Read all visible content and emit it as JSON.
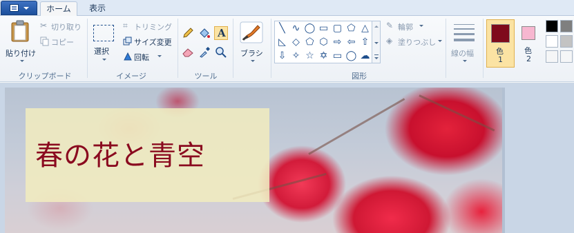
{
  "tabs": {
    "home": "ホーム",
    "view": "表示"
  },
  "clipboard": {
    "paste": "貼り付け",
    "cut": "切り取り",
    "copy": "コピー",
    "group": "クリップボード"
  },
  "image": {
    "select": "選択",
    "crop": "トリミング",
    "resize": "サイズ変更",
    "rotate": "回転",
    "group": "イメージ"
  },
  "tools": {
    "group": "ツール"
  },
  "brushes": {
    "label": "ブラシ"
  },
  "shapes": {
    "outline": "輪郭",
    "fill": "塗りつぶし",
    "group": "図形"
  },
  "size": {
    "label": "線の幅"
  },
  "colors": {
    "color1_label": "色",
    "color1_num": "1",
    "color2_label": "色",
    "color2_num": "2",
    "color1_value": "#7f0a1c",
    "color2_value": "#f7b7d0"
  },
  "canvas": {
    "text": "春の花と青空"
  }
}
